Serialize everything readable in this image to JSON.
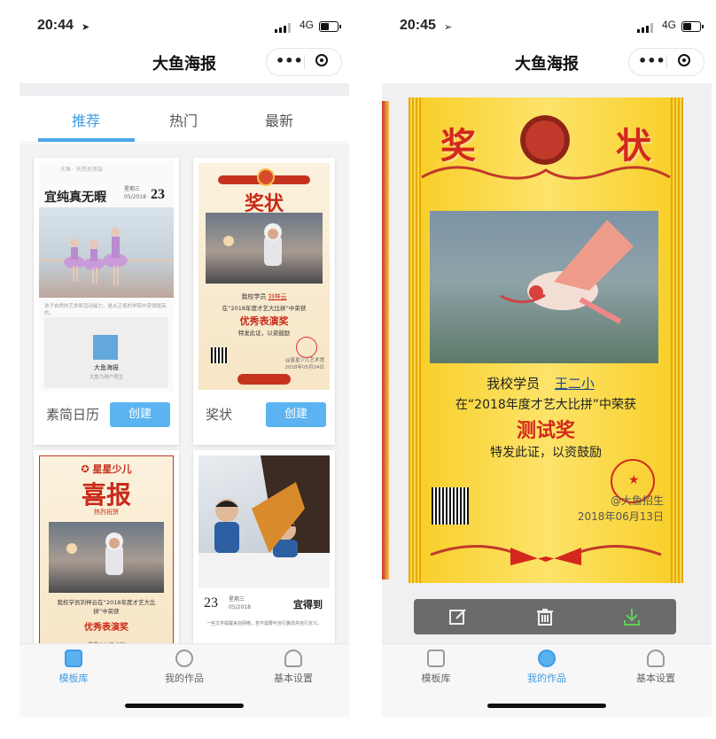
{
  "colors": {
    "accent": "#3c9de6",
    "button": "#5bb4f1",
    "certificate_gold": "#fbd43a",
    "certificate_red": "#c82a18"
  },
  "left": {
    "status": {
      "time": "20:44",
      "network": "4G"
    },
    "header": {
      "title": "大鱼海报"
    },
    "tabs": [
      {
        "label": "推荐",
        "active": true
      },
      {
        "label": "热门",
        "active": false
      },
      {
        "label": "最新",
        "active": false
      }
    ],
    "cards": [
      {
        "name": "素简日历",
        "button": "创建",
        "preview": {
          "top": "大鱼 · 天然无添加",
          "title": "宜纯真无暇",
          "weekday": "星期三",
          "date": "05/2018",
          "day": "23",
          "desc": "孩子自然的艺术和活动能力，是从正规的学院中获得提高的。",
          "brand": "大鱼海报",
          "brand_sub": "大鱼为用户而生"
        }
      },
      {
        "name": "奖状",
        "button": "创建",
        "preview": {
          "title": "奖状",
          "line1": "我校学员",
          "student": "刘梓云",
          "line2": "在“2018年度才艺大比拼”中荣获",
          "award": "优秀表演奖",
          "line3": "特发此证，以资鼓励",
          "org": "@星星少儿艺术馆",
          "date": "2018年05月24日"
        }
      },
      {
        "preview": {
          "brand": "星星少儿",
          "title": "喜报",
          "subtitle": "热烈祝贺",
          "text": "我校学员刘梓云在“2018年度才艺大比拼”中荣获",
          "award": "优秀表演奖",
          "tail": "星星少儿艺术馆"
        }
      },
      {
        "preview": {
          "day": "23",
          "weekday": "星期三",
          "date": "05/2018",
          "saying": "宜得到",
          "note": "一些文字提醒来自网络，若不需要可自行删改并自行定义。"
        }
      }
    ],
    "tabbar": [
      {
        "label": "模板库",
        "active": true
      },
      {
        "label": "我的作品",
        "active": false
      },
      {
        "label": "基本设置",
        "active": false
      }
    ]
  },
  "right": {
    "status": {
      "time": "20:45",
      "network": "4G"
    },
    "header": {
      "title": "大鱼海报"
    },
    "certificate": {
      "title_left": "奖",
      "title_right": "状",
      "line1": "我校学员",
      "student": "王二小",
      "line2": "在“2018年度才艺大比拼”中荣获",
      "award": "测试奖",
      "line3": "特发此证，以资鼓励",
      "org": "@大鱼招生",
      "date": "2018年06月13日"
    },
    "toolbar": [
      {
        "icon": "edit-icon"
      },
      {
        "icon": "trash-icon"
      },
      {
        "icon": "download-icon"
      }
    ],
    "tabbar": [
      {
        "label": "模板库",
        "active": false
      },
      {
        "label": "我的作品",
        "active": true
      },
      {
        "label": "基本设置",
        "active": false
      }
    ]
  }
}
